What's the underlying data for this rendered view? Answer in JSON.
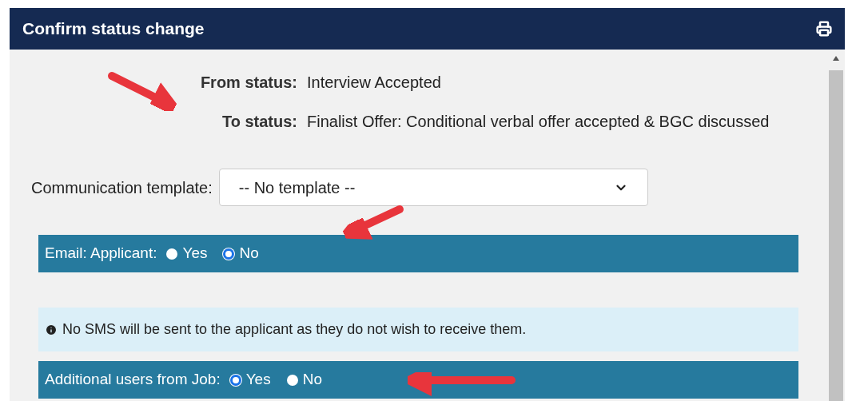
{
  "window": {
    "title": "Confirm status change"
  },
  "status": [
    {
      "label": "From status:",
      "value": "Interview Accepted"
    },
    {
      "label": "To status:",
      "value": "Finalist Offer: Conditional verbal offer accepted & BGC discussed"
    }
  ],
  "template": {
    "label": "Communication template:",
    "value": "-- No template --"
  },
  "email": {
    "label": "Email: Applicant:",
    "options": [
      {
        "label": "Yes",
        "selected": false
      },
      {
        "label": "No",
        "selected": true
      }
    ]
  },
  "notice": {
    "text": "No SMS will be sent to the applicant as they do not wish to receive them."
  },
  "additional": {
    "label": "Additional users from Job:",
    "options": [
      {
        "label": "Yes",
        "selected": true
      },
      {
        "label": "No",
        "selected": false
      }
    ]
  }
}
